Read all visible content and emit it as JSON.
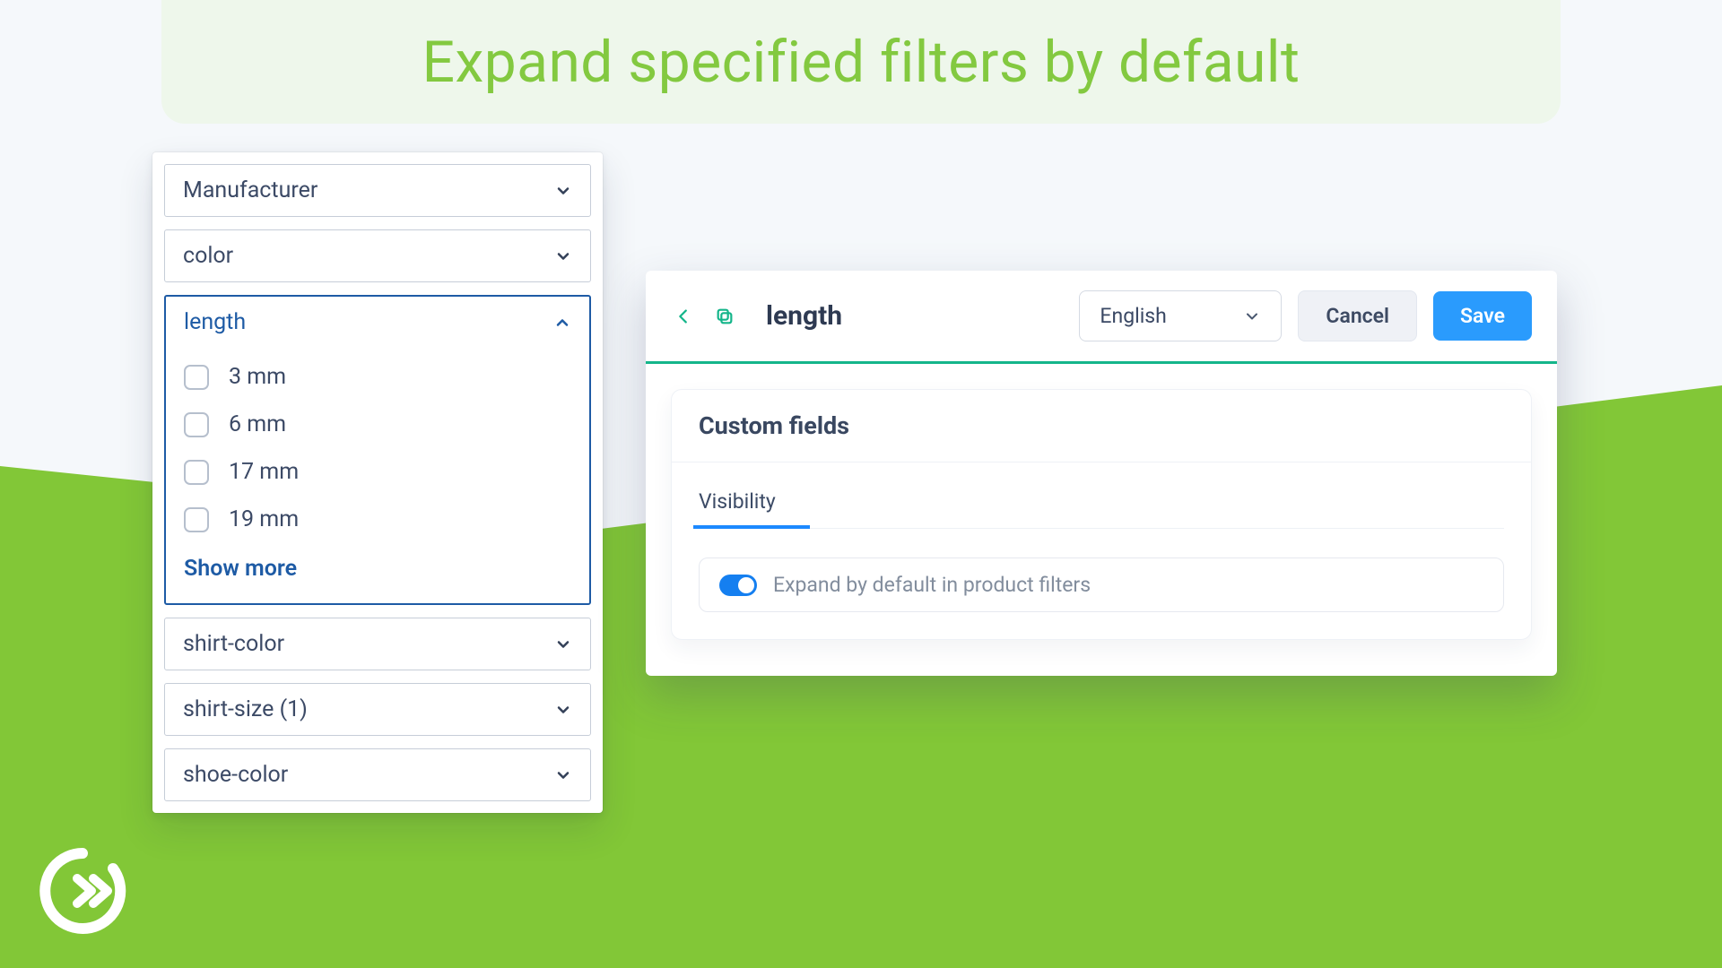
{
  "banner": {
    "title": "Expand specified filters by default"
  },
  "filters": {
    "manufacturer": {
      "label": "Manufacturer"
    },
    "color": {
      "label": "color"
    },
    "length": {
      "label": "length",
      "options": [
        "3 mm",
        "6 mm",
        "17 mm",
        "19 mm"
      ],
      "showMore": "Show more"
    },
    "shirt_color": {
      "label": "shirt-color"
    },
    "shirt_size": {
      "label": "shirt-size (1)"
    },
    "shoe_color": {
      "label": "shoe-color"
    }
  },
  "panel": {
    "title": "length",
    "language": "English",
    "cancel": "Cancel",
    "save": "Save",
    "cardTitle": "Custom fields",
    "tab": "Visibility",
    "toggleLabel": "Expand by default in product filters"
  }
}
